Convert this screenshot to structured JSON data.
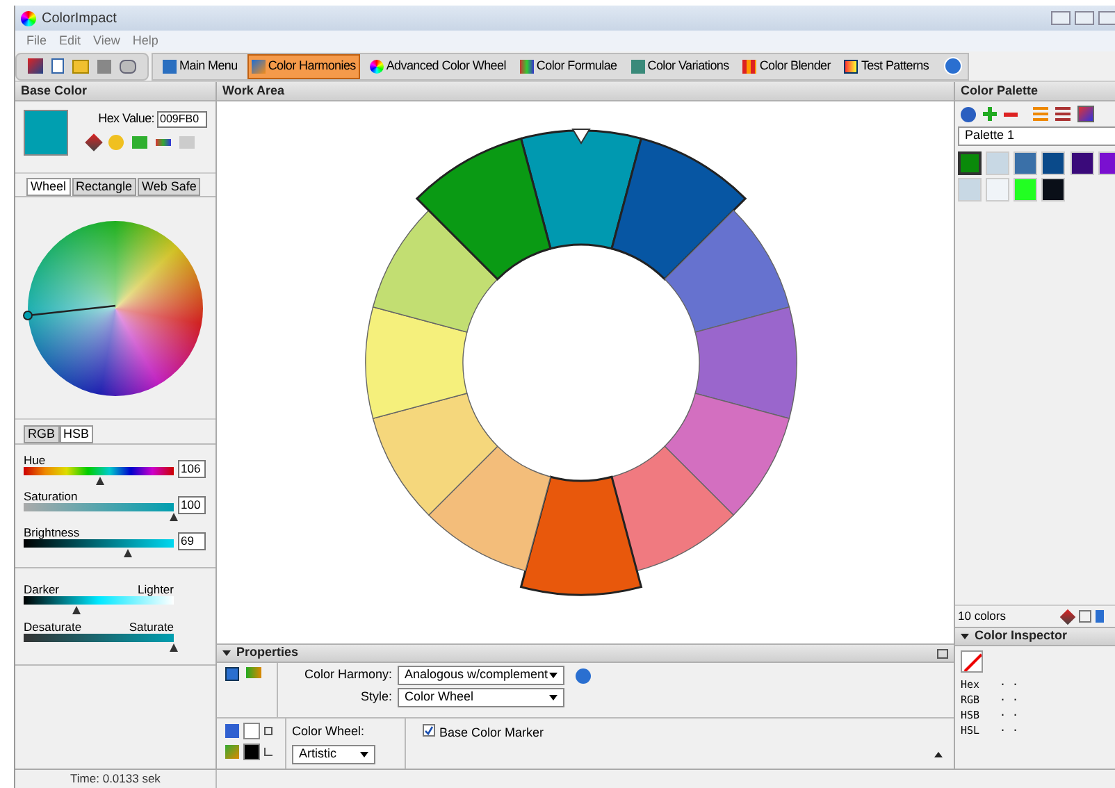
{
  "window": {
    "title": "ColorImpact"
  },
  "menu": [
    "File",
    "Edit",
    "View",
    "Help"
  ],
  "toolbar": [
    {
      "label": "Main Menu",
      "selected": false
    },
    {
      "label": "Color Harmonies",
      "selected": true
    },
    {
      "label": "Advanced Color Wheel",
      "selected": false
    },
    {
      "label": "Color Formulae",
      "selected": false
    },
    {
      "label": "Color Variations",
      "selected": false
    },
    {
      "label": "Color Blender",
      "selected": false
    },
    {
      "label": "Test Patterns",
      "selected": false
    }
  ],
  "base_color": {
    "title": "Base Color",
    "color": "#009fb0",
    "hex_label": "Hex Value:",
    "hex_value": "009FB0",
    "tabs": [
      {
        "label": "Wheel",
        "selected": true
      },
      {
        "label": "Rectangle",
        "selected": false
      },
      {
        "label": "Web Safe",
        "selected": false
      }
    ],
    "mode_tabs": [
      {
        "label": "RGB",
        "selected": false
      },
      {
        "label": "HSB",
        "selected": true
      }
    ],
    "sliders": [
      {
        "kind": "hue",
        "label": "Hue",
        "value": "106",
        "level": 0.51
      },
      {
        "kind": "saturation",
        "label": "Saturation",
        "value": "100",
        "level": 1.0
      },
      {
        "kind": "brightness",
        "label": "Brightness",
        "value": "69",
        "level": 0.69
      }
    ],
    "adjust": [
      {
        "kind": "lightness",
        "left": "Darker",
        "right": "Lighter",
        "level": 0.35
      },
      {
        "kind": "saturation",
        "left": "Desaturate",
        "right": "Saturate",
        "level": 1.0
      }
    ]
  },
  "work_area": {
    "title": "Work Area",
    "segments": [
      {
        "color": "#0099b0",
        "selected": true
      },
      {
        "color": "#0756a3",
        "selected": true
      },
      {
        "color": "#6672cf",
        "selected": false
      },
      {
        "color": "#9a66cc",
        "selected": false
      },
      {
        "color": "#d36fc0",
        "selected": false
      },
      {
        "color": "#f07a80",
        "selected": false
      },
      {
        "color": "#e8580c",
        "selected": true
      },
      {
        "color": "#f3bd7a",
        "selected": false
      },
      {
        "color": "#f5d77c",
        "selected": false
      },
      {
        "color": "#f5f07c",
        "selected": false
      },
      {
        "color": "#c2de72",
        "selected": false
      },
      {
        "color": "#0a9a14",
        "selected": true
      }
    ]
  },
  "properties": {
    "title": "Properties",
    "harmony_label": "Color Harmony:",
    "harmony_value": "Analogous w/complement",
    "style_label": "Style:",
    "style_value": "Color Wheel",
    "wheel_label": "Color Wheel:",
    "wheel_value": "Artistic",
    "marker_label": "Base Color Marker",
    "marker_checked": true
  },
  "palette": {
    "title": "Color Palette",
    "selected_palette": "Palette 1",
    "swatches": [
      {
        "color": "#0a8a0a",
        "selected": true
      },
      {
        "color": "#c8d8e4",
        "selected": false
      },
      {
        "color": "#3a70a8",
        "selected": false
      },
      {
        "color": "#0a4a8a",
        "selected": false
      },
      {
        "color": "#3a0a7a",
        "selected": false
      },
      {
        "color": "#7a10d0",
        "selected": false
      },
      {
        "color": "#c8d8e4",
        "selected": false
      },
      {
        "color": "#f0f4f8",
        "selected": false
      },
      {
        "color": "#22ff22",
        "selected": false
      },
      {
        "color": "#0a0f18",
        "selected": false
      }
    ],
    "count": "10 colors"
  },
  "inspector": {
    "title": "Color Inspector",
    "rows": [
      {
        "label": "Hex",
        "value": "· ·"
      },
      {
        "label": "RGB",
        "value": "· ·"
      },
      {
        "label": "HSB",
        "value": "· ·"
      },
      {
        "label": "HSL",
        "value": "· ·"
      }
    ]
  },
  "status_bar": "Time: 0.0133 sek"
}
